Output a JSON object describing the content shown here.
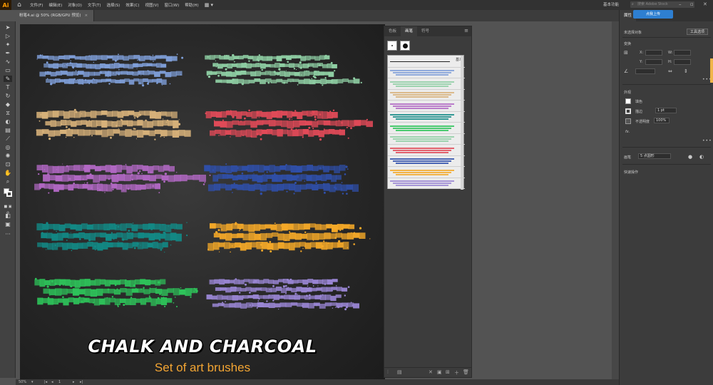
{
  "app": {
    "logo": "Ai",
    "menu": [
      "文件(F)",
      "编辑(E)",
      "对象(O)",
      "文字(T)",
      "选择(S)",
      "效果(C)",
      "视图(V)",
      "窗口(W)",
      "帮助(H)"
    ],
    "workspace_label": "基本功能",
    "search_placeholder": "搜索 Adobe Stock",
    "cloud_upload_label": "点我上传"
  },
  "document": {
    "tab_title": "粉笔4.ai @ 50% (RGB/GPU 预览)",
    "zoom": "50%",
    "artboard_number": "1",
    "title_text": "CHALK AND CHARCOAL",
    "subtitle_text": "Set of art brushes"
  },
  "brush_panel": {
    "tabs": [
      "色板",
      "画笔",
      "符号"
    ],
    "active_tab": "画笔",
    "basic_label": "基本"
  },
  "properties": {
    "tabs": [
      "属性",
      "库"
    ],
    "active_tab": "属性",
    "no_selection": "未选择对象",
    "tool_options_button": "工具选项",
    "transform_heading": "变换",
    "transform_fields": {
      "x": "X:",
      "y": "Y:",
      "w": "W:",
      "h": "H:"
    },
    "appearance_heading": "外观",
    "fill_label": "填色",
    "stroke_label": "描边",
    "stroke_value": "1 pt",
    "opacity_label": "不透明度",
    "opacity_value": "100%",
    "fx_label": "fx.",
    "align_label": "画笔",
    "brush_value": "5 点圆形",
    "quick_actions": "快速操作"
  },
  "colors": {
    "chalk_blue": "#7f9fd9",
    "chalk_mint": "#8fcfa4",
    "chalk_tan": "#d8b27a",
    "chalk_red": "#e24a58",
    "chalk_purple": "#b268c4",
    "chalk_navy": "#2f4faa",
    "chalk_teal": "#128a86",
    "chalk_orange": "#f5a928",
    "chalk_green": "#2ec45a",
    "chalk_lavender": "#9a86d4"
  }
}
